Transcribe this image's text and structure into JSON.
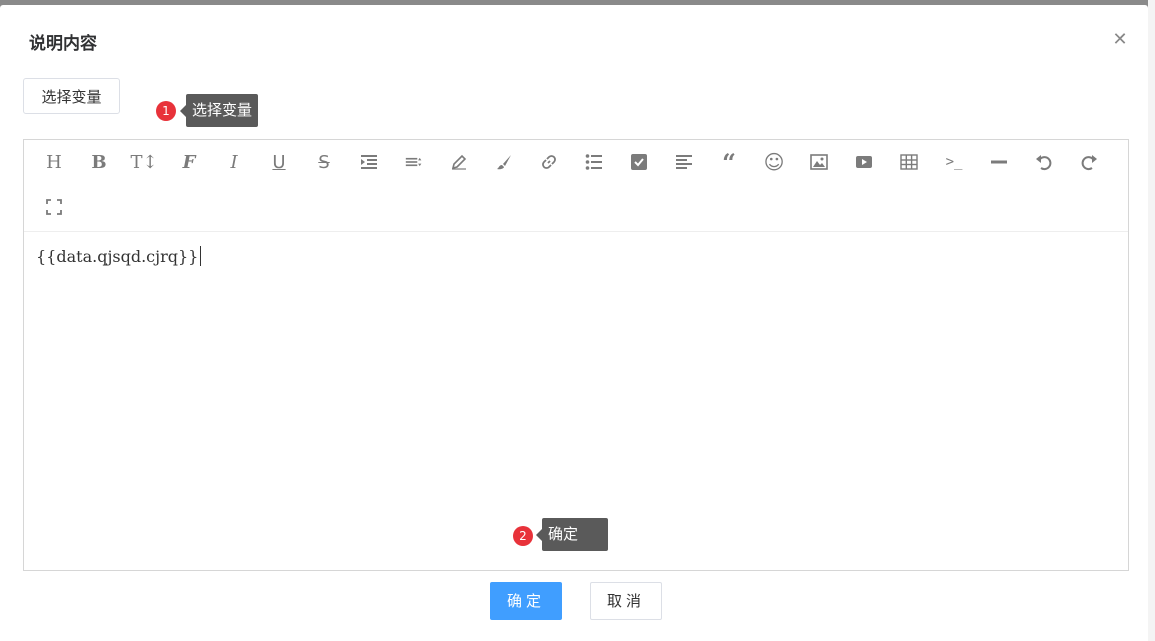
{
  "dialog": {
    "title": "说明内容",
    "close_icon": "close-icon"
  },
  "select_variable_button": {
    "label": "选择变量"
  },
  "annotations": [
    {
      "number": "1",
      "label": "选择变量"
    },
    {
      "number": "2",
      "label": "确定"
    }
  ],
  "toolbar": {
    "items": [
      {
        "name": "heading-icon",
        "glyph": "H"
      },
      {
        "name": "bold-icon",
        "glyph": "B"
      },
      {
        "name": "font-size-icon",
        "glyph": "T↕"
      },
      {
        "name": "font-family-icon",
        "glyph": "𝓕"
      },
      {
        "name": "italic-icon",
        "glyph": "I"
      },
      {
        "name": "underline-icon",
        "glyph": "U"
      },
      {
        "name": "strikethrough-icon",
        "glyph": "S"
      },
      {
        "name": "indent-icon",
        "glyph": "indent"
      },
      {
        "name": "line-height-icon",
        "glyph": "lineheight"
      },
      {
        "name": "font-color-icon",
        "glyph": "pencil"
      },
      {
        "name": "background-color-icon",
        "glyph": "brush"
      },
      {
        "name": "link-icon",
        "glyph": "link"
      },
      {
        "name": "list-icon",
        "glyph": "list"
      },
      {
        "name": "todo-icon",
        "glyph": "check"
      },
      {
        "name": "align-icon",
        "glyph": "align"
      },
      {
        "name": "quote-icon",
        "glyph": "❝"
      },
      {
        "name": "emoji-icon",
        "glyph": "☺"
      },
      {
        "name": "image-icon",
        "glyph": "image"
      },
      {
        "name": "video-icon",
        "glyph": "video"
      },
      {
        "name": "table-icon",
        "glyph": "table"
      },
      {
        "name": "code-icon",
        "glyph": ">_"
      },
      {
        "name": "divider-icon",
        "glyph": "hr"
      },
      {
        "name": "undo-icon",
        "glyph": "undo"
      },
      {
        "name": "redo-icon",
        "glyph": "redo"
      },
      {
        "name": "fullscreen-icon",
        "glyph": "full"
      }
    ]
  },
  "editor": {
    "content": "{{data.qjsqd.cjrq}}"
  },
  "footer": {
    "confirm_label": "确定",
    "cancel_label": "取消"
  }
}
